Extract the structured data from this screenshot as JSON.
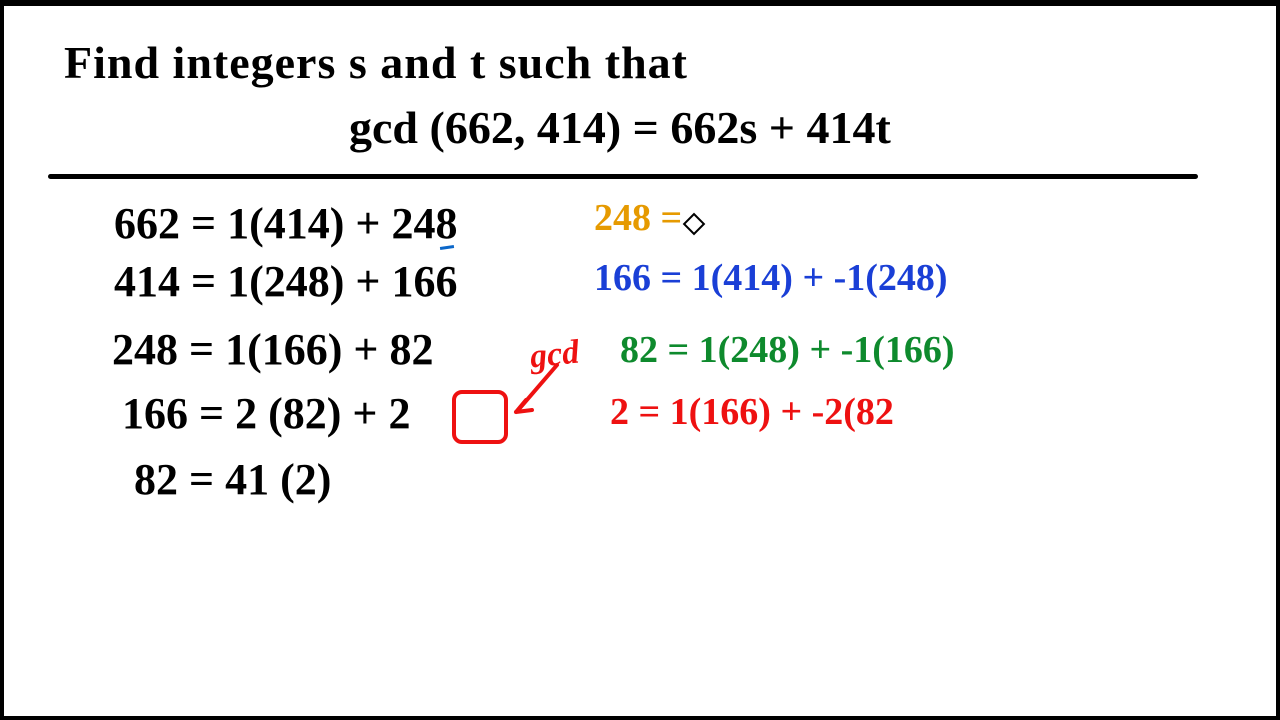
{
  "header": {
    "line1": "Find  integers   s   and   t    such  that",
    "line2": "gcd (662, 414) = 662s + 414t"
  },
  "euclid": {
    "step1": "662 = 1(414) + 248",
    "step2": "414 = 1(248) + 166",
    "step3": "248 = 1(166) +  82",
    "step4": "166 = 2 (82) +  2",
    "step5": "82 = 41 (2)"
  },
  "gcd_label": "gcd",
  "back": {
    "r1": "248 =",
    "r2": "166 = 1(414) + -1(248)",
    "r3": "82 = 1(248) + -1(166)",
    "r4": "2 = 1(166) + -2(82"
  },
  "colors": {
    "orange": "#e69a00",
    "blue": "#1a3fd6",
    "green": "#0e8a2d",
    "red": "#e11"
  }
}
